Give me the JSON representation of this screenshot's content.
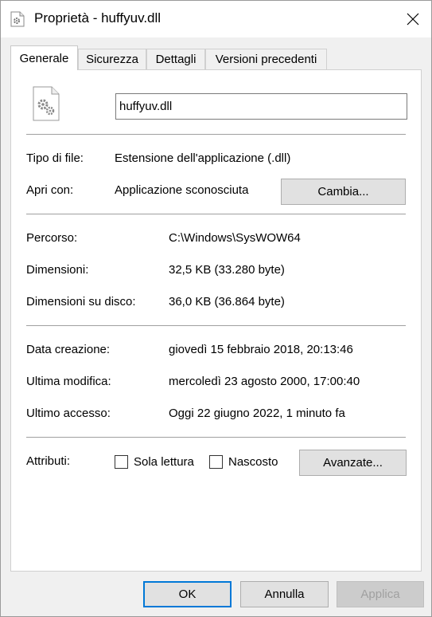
{
  "window": {
    "title": "Proprietà - huffyuv.dll"
  },
  "tabs": [
    {
      "label": "Generale",
      "active": true
    },
    {
      "label": "Sicurezza",
      "active": false
    },
    {
      "label": "Dettagli",
      "active": false
    },
    {
      "label": "Versioni precedenti",
      "active": false
    }
  ],
  "general": {
    "file_name": "huffyuv.dll",
    "file_type_label": "Tipo di file:",
    "file_type_value": "Estensione dell'applicazione (.dll)",
    "opens_with_label": "Apri con:",
    "opens_with_value": "Applicazione sconosciuta",
    "change_button": "Cambia...",
    "location_label": "Percorso:",
    "location_value": "C:\\Windows\\SysWOW64",
    "size_label": "Dimensioni:",
    "size_value": "32,5 KB (33.280 byte)",
    "size_on_disk_label": "Dimensioni su disco:",
    "size_on_disk_value": "36,0 KB (36.864 byte)",
    "created_label": "Data creazione:",
    "created_value": "giovedì 15 febbraio 2018, 20:13:46",
    "modified_label": "Ultima modifica:",
    "modified_value": "mercoledì 23 agosto 2000, 17:00:40",
    "accessed_label": "Ultimo accesso:",
    "accessed_value": "Oggi 22 giugno 2022, 1 minuto fa",
    "attributes_label": "Attributi:",
    "readonly_label": "Sola lettura",
    "readonly_checked": false,
    "hidden_label": "Nascosto",
    "hidden_checked": false,
    "advanced_button": "Avanzate..."
  },
  "footer": {
    "ok": "OK",
    "cancel": "Annulla",
    "apply": "Applica"
  },
  "colors": {
    "accent": "#0078d7",
    "panel": "#ffffff",
    "window": "#f0f0f0"
  }
}
